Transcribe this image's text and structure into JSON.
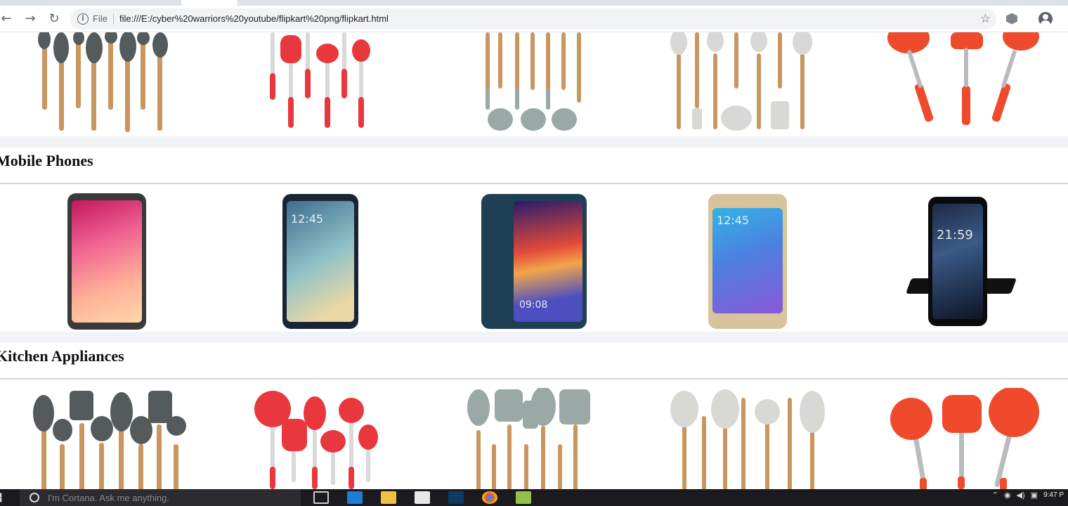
{
  "browser": {
    "file_label": "File",
    "url": "file:///E:/cyber%20warriors%20youtube/flipkart%20png/flipkart.html"
  },
  "sections": [
    {
      "title": "Mobile Phones"
    },
    {
      "title": "Kitchen Appliances"
    }
  ],
  "phones": [
    {
      "model": "iphone-x",
      "time": ""
    },
    {
      "model": "galaxy-s6-edge",
      "time": "12:45"
    },
    {
      "model": "huawei-p20-pro",
      "time": "09:08"
    },
    {
      "model": "galaxy-note-5",
      "time": "12:45"
    },
    {
      "model": "black-android",
      "time": "21:59"
    }
  ],
  "taskbar": {
    "search_placeholder": "I'm Cortana. Ask me anything.",
    "clock": "9:47 P"
  },
  "colors": {
    "accent_red": "#e8383d",
    "orange_red": "#ee4a2b",
    "sage": "#9aa9a6",
    "wood": "#c99660",
    "dark_gray": "#555a5c"
  }
}
